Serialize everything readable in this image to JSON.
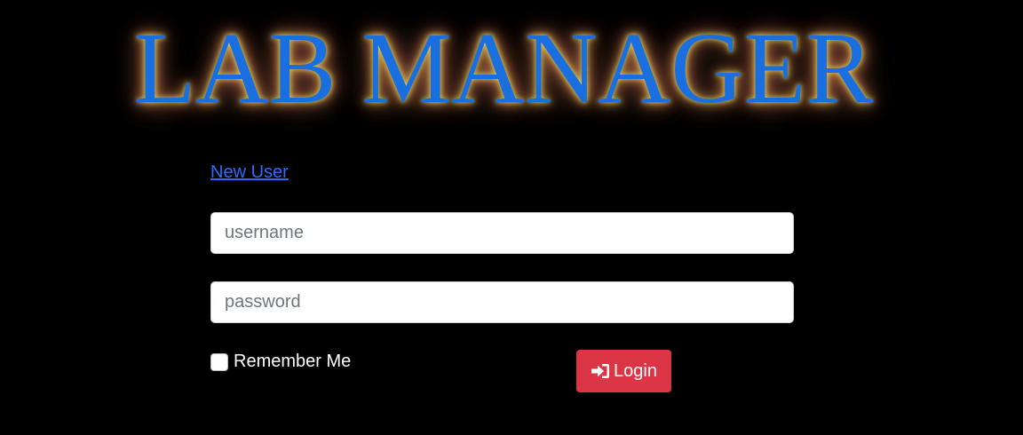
{
  "app": {
    "title": "LAB MANAGER"
  },
  "links": {
    "new_user": "New User"
  },
  "form": {
    "username_placeholder": "username",
    "password_placeholder": "password",
    "remember_label": "Remember Me",
    "remember_checked": false,
    "login_label": "Login"
  },
  "icons": {
    "login": "sign-in-icon"
  },
  "colors": {
    "background": "#000000",
    "title": "#1a6fe0",
    "title_glow": "#d8c85a",
    "link": "#2b6cff",
    "login_button": "#dc3545"
  }
}
